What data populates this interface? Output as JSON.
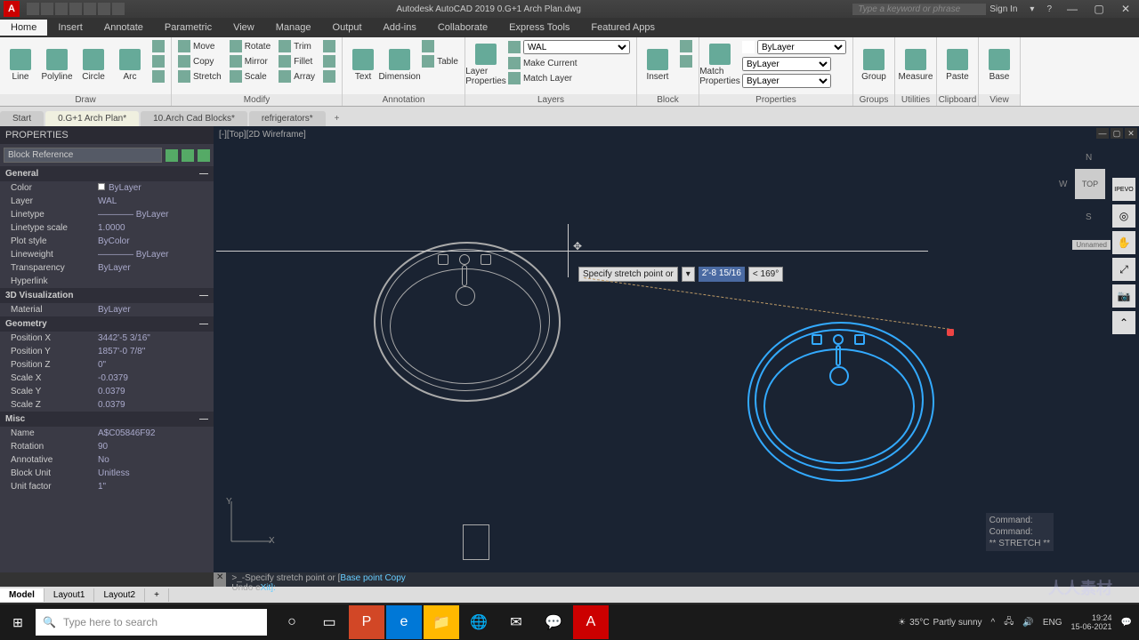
{
  "titlebar": {
    "app_icon": "A",
    "title": "Autodesk AutoCAD 2019    0.G+1 Arch Plan.dwg",
    "search_placeholder": "Type a keyword or phrase",
    "signin": "Sign In",
    "min": "—",
    "max": "▢",
    "close": "✕"
  },
  "ribbon_tabs": [
    "Home",
    "Insert",
    "Annotate",
    "Parametric",
    "View",
    "Manage",
    "Output",
    "Add-ins",
    "Collaborate",
    "Express Tools",
    "Featured Apps"
  ],
  "ribbon": {
    "draw": {
      "title": "Draw",
      "line": "Line",
      "polyline": "Polyline",
      "circle": "Circle",
      "arc": "Arc"
    },
    "modify": {
      "title": "Modify",
      "move": "Move",
      "rotate": "Rotate",
      "trim": "Trim",
      "copy": "Copy",
      "mirror": "Mirror",
      "fillet": "Fillet",
      "stretch": "Stretch",
      "scale": "Scale",
      "array": "Array"
    },
    "annotation": {
      "title": "Annotation",
      "text": "Text",
      "dimension": "Dimension",
      "table": "Table"
    },
    "layers": {
      "title": "Layers",
      "layer_props": "Layer\nProperties",
      "current": "WAL",
      "make_current": "Make Current",
      "match": "Match Layer"
    },
    "block": {
      "title": "Block",
      "insert": "Insert"
    },
    "properties": {
      "title": "Properties",
      "match": "Match\nProperties",
      "bylayer1": "ByLayer",
      "bylayer2": "ByLayer",
      "bylayer3": "ByLayer"
    },
    "groups": {
      "title": "Groups",
      "group": "Group"
    },
    "utilities": {
      "title": "Utilities",
      "measure": "Measure"
    },
    "clipboard": {
      "title": "Clipboard",
      "paste": "Paste"
    },
    "view": {
      "title": "View",
      "base": "Base"
    }
  },
  "dwg_tabs": [
    "Start",
    "0.G+1 Arch Plan*",
    "10.Arch Cad Blocks*",
    "refrigerators*"
  ],
  "properties": {
    "title": "PROPERTIES",
    "object": "Block Reference",
    "sections": {
      "general": {
        "title": "General",
        "rows": [
          {
            "k": "Color",
            "v": "ByLayer",
            "swatch": true
          },
          {
            "k": "Layer",
            "v": "WAL"
          },
          {
            "k": "Linetype",
            "v": "———— ByLayer"
          },
          {
            "k": "Linetype scale",
            "v": "1.0000"
          },
          {
            "k": "Plot style",
            "v": "ByColor"
          },
          {
            "k": "Lineweight",
            "v": "———— ByLayer"
          },
          {
            "k": "Transparency",
            "v": "ByLayer"
          },
          {
            "k": "Hyperlink",
            "v": ""
          }
        ]
      },
      "viz": {
        "title": "3D Visualization",
        "rows": [
          {
            "k": "Material",
            "v": "ByLayer"
          }
        ]
      },
      "geom": {
        "title": "Geometry",
        "rows": [
          {
            "k": "Position X",
            "v": "3442'-5 3/16\""
          },
          {
            "k": "Position Y",
            "v": "1857'-0 7/8\""
          },
          {
            "k": "Position Z",
            "v": "0\""
          },
          {
            "k": "Scale X",
            "v": "-0.0379"
          },
          {
            "k": "Scale Y",
            "v": "0.0379"
          },
          {
            "k": "Scale Z",
            "v": "0.0379"
          }
        ]
      },
      "misc": {
        "title": "Misc",
        "rows": [
          {
            "k": "Name",
            "v": "A$C05846F92"
          },
          {
            "k": "Rotation",
            "v": "90"
          },
          {
            "k": "Annotative",
            "v": "No"
          },
          {
            "k": "Block Unit",
            "v": "Unitless"
          },
          {
            "k": "Unit factor",
            "v": "1\""
          }
        ]
      }
    }
  },
  "canvas": {
    "view_label": "[-][Top][2D Wireframe]",
    "prompt": "Specify stretch point or",
    "prompt_value": "2'-8 15/16",
    "prompt_angle": "< 169°",
    "history": [
      "Command:",
      "Command:",
      "** STRETCH **"
    ],
    "viewcube": {
      "top": "TOP",
      "n": "N",
      "s": "S",
      "w": "W"
    },
    "logo": "IPEVO",
    "unnamed": "Unnamed"
  },
  "cmdline": {
    "text_pre": ">_-Specify stretch point or [",
    "base": "Base point ",
    "copy": "Copy",
    "text_post": "",
    "line2_pre": "Undo e",
    "xit": "Xit]:"
  },
  "layout_tabs": [
    "Model",
    "Layout1",
    "Layout2"
  ],
  "statusbar": {
    "model": "MODEL"
  },
  "taskbar": {
    "search_placeholder": "Type here to search",
    "weather_temp": "35°C",
    "weather_cond": "Partly sunny",
    "lang": "ENG",
    "time": "19:24",
    "date": "15-06-2021"
  },
  "watermark": "人人素材"
}
